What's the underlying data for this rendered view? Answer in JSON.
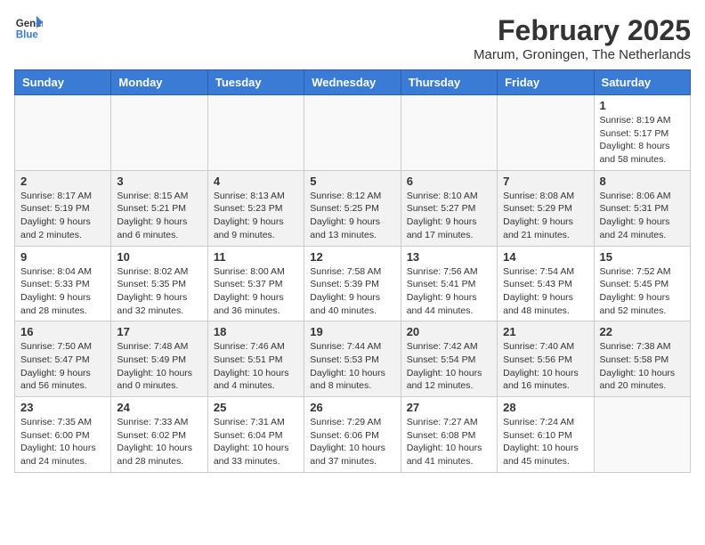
{
  "header": {
    "logo_line1": "General",
    "logo_line2": "Blue",
    "month_title": "February 2025",
    "subtitle": "Marum, Groningen, The Netherlands"
  },
  "weekdays": [
    "Sunday",
    "Monday",
    "Tuesday",
    "Wednesday",
    "Thursday",
    "Friday",
    "Saturday"
  ],
  "weeks": [
    [
      {
        "day": "",
        "info": ""
      },
      {
        "day": "",
        "info": ""
      },
      {
        "day": "",
        "info": ""
      },
      {
        "day": "",
        "info": ""
      },
      {
        "day": "",
        "info": ""
      },
      {
        "day": "",
        "info": ""
      },
      {
        "day": "1",
        "info": "Sunrise: 8:19 AM\nSunset: 5:17 PM\nDaylight: 8 hours and 58 minutes."
      }
    ],
    [
      {
        "day": "2",
        "info": "Sunrise: 8:17 AM\nSunset: 5:19 PM\nDaylight: 9 hours and 2 minutes."
      },
      {
        "day": "3",
        "info": "Sunrise: 8:15 AM\nSunset: 5:21 PM\nDaylight: 9 hours and 6 minutes."
      },
      {
        "day": "4",
        "info": "Sunrise: 8:13 AM\nSunset: 5:23 PM\nDaylight: 9 hours and 9 minutes."
      },
      {
        "day": "5",
        "info": "Sunrise: 8:12 AM\nSunset: 5:25 PM\nDaylight: 9 hours and 13 minutes."
      },
      {
        "day": "6",
        "info": "Sunrise: 8:10 AM\nSunset: 5:27 PM\nDaylight: 9 hours and 17 minutes."
      },
      {
        "day": "7",
        "info": "Sunrise: 8:08 AM\nSunset: 5:29 PM\nDaylight: 9 hours and 21 minutes."
      },
      {
        "day": "8",
        "info": "Sunrise: 8:06 AM\nSunset: 5:31 PM\nDaylight: 9 hours and 24 minutes."
      }
    ],
    [
      {
        "day": "9",
        "info": "Sunrise: 8:04 AM\nSunset: 5:33 PM\nDaylight: 9 hours and 28 minutes."
      },
      {
        "day": "10",
        "info": "Sunrise: 8:02 AM\nSunset: 5:35 PM\nDaylight: 9 hours and 32 minutes."
      },
      {
        "day": "11",
        "info": "Sunrise: 8:00 AM\nSunset: 5:37 PM\nDaylight: 9 hours and 36 minutes."
      },
      {
        "day": "12",
        "info": "Sunrise: 7:58 AM\nSunset: 5:39 PM\nDaylight: 9 hours and 40 minutes."
      },
      {
        "day": "13",
        "info": "Sunrise: 7:56 AM\nSunset: 5:41 PM\nDaylight: 9 hours and 44 minutes."
      },
      {
        "day": "14",
        "info": "Sunrise: 7:54 AM\nSunset: 5:43 PM\nDaylight: 9 hours and 48 minutes."
      },
      {
        "day": "15",
        "info": "Sunrise: 7:52 AM\nSunset: 5:45 PM\nDaylight: 9 hours and 52 minutes."
      }
    ],
    [
      {
        "day": "16",
        "info": "Sunrise: 7:50 AM\nSunset: 5:47 PM\nDaylight: 9 hours and 56 minutes."
      },
      {
        "day": "17",
        "info": "Sunrise: 7:48 AM\nSunset: 5:49 PM\nDaylight: 10 hours and 0 minutes."
      },
      {
        "day": "18",
        "info": "Sunrise: 7:46 AM\nSunset: 5:51 PM\nDaylight: 10 hours and 4 minutes."
      },
      {
        "day": "19",
        "info": "Sunrise: 7:44 AM\nSunset: 5:53 PM\nDaylight: 10 hours and 8 minutes."
      },
      {
        "day": "20",
        "info": "Sunrise: 7:42 AM\nSunset: 5:54 PM\nDaylight: 10 hours and 12 minutes."
      },
      {
        "day": "21",
        "info": "Sunrise: 7:40 AM\nSunset: 5:56 PM\nDaylight: 10 hours and 16 minutes."
      },
      {
        "day": "22",
        "info": "Sunrise: 7:38 AM\nSunset: 5:58 PM\nDaylight: 10 hours and 20 minutes."
      }
    ],
    [
      {
        "day": "23",
        "info": "Sunrise: 7:35 AM\nSunset: 6:00 PM\nDaylight: 10 hours and 24 minutes."
      },
      {
        "day": "24",
        "info": "Sunrise: 7:33 AM\nSunset: 6:02 PM\nDaylight: 10 hours and 28 minutes."
      },
      {
        "day": "25",
        "info": "Sunrise: 7:31 AM\nSunset: 6:04 PM\nDaylight: 10 hours and 33 minutes."
      },
      {
        "day": "26",
        "info": "Sunrise: 7:29 AM\nSunset: 6:06 PM\nDaylight: 10 hours and 37 minutes."
      },
      {
        "day": "27",
        "info": "Sunrise: 7:27 AM\nSunset: 6:08 PM\nDaylight: 10 hours and 41 minutes."
      },
      {
        "day": "28",
        "info": "Sunrise: 7:24 AM\nSunset: 6:10 PM\nDaylight: 10 hours and 45 minutes."
      },
      {
        "day": "",
        "info": ""
      }
    ]
  ]
}
